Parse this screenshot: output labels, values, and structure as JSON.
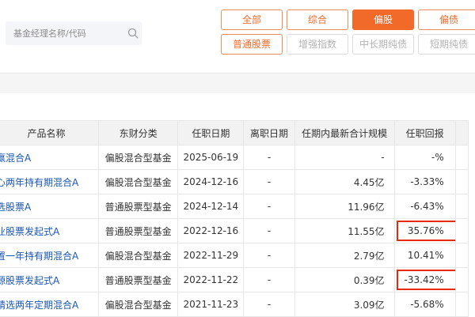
{
  "search": {
    "placeholder": "基金经理名称/代码"
  },
  "filters": {
    "row1": [
      {
        "label": "全部",
        "state": "normal"
      },
      {
        "label": "综合",
        "state": "normal"
      },
      {
        "label": "偏股",
        "state": "active"
      },
      {
        "label": "偏债",
        "state": "normal"
      }
    ],
    "row2": [
      {
        "label": "普通股票",
        "state": "normal"
      },
      {
        "label": "增强指数",
        "state": "disabled"
      },
      {
        "label": "中长期纯债",
        "state": "disabled"
      },
      {
        "label": "短期纯债",
        "state": "disabled"
      }
    ]
  },
  "table": {
    "headers": [
      "产品名称",
      "东财分类",
      "任职日期",
      "离职日期",
      "任期内最新合计规模",
      "任职回报"
    ],
    "rows": [
      {
        "name": "共赢混合A",
        "category": "偏股混合型基金",
        "start": "2025-06-19",
        "end": "-",
        "scale": "-",
        "return": "-%",
        "trend": "none",
        "highlight": false
      },
      {
        "name": "核心两年持有期混合A",
        "category": "偏股混合型基金",
        "start": "2024-12-16",
        "end": "-",
        "scale": "4.45亿",
        "return": "-3.33%",
        "trend": "neg",
        "highlight": false
      },
      {
        "name": "优选股票A",
        "category": "普通股票型基金",
        "start": "2024-12-14",
        "end": "-",
        "scale": "11.96亿",
        "return": "-6.43%",
        "trend": "neg",
        "highlight": false
      },
      {
        "name": "产业股票发起式A",
        "category": "普通股票型基金",
        "start": "2022-12-16",
        "end": "-",
        "scale": "11.55亿",
        "return": "35.76%",
        "trend": "pos",
        "highlight": true
      },
      {
        "name": "配置一年持有期混合A",
        "category": "偏股混合型基金",
        "start": "2022-11-29",
        "end": "-",
        "scale": "2.79亿",
        "return": "10.41%",
        "trend": "pos",
        "highlight": false
      },
      {
        "name": "能源股票发起式A",
        "category": "普通股票型基金",
        "start": "2022-11-22",
        "end": "-",
        "scale": "0.39亿",
        "return": "-33.42%",
        "trend": "neg",
        "highlight": true
      },
      {
        "name": "所精选两年定期混合A",
        "category": "偏股混合型基金",
        "start": "2021-11-23",
        "end": "-",
        "scale": "3.09亿",
        "return": "-5.68%",
        "trend": "neg",
        "highlight": false
      }
    ]
  },
  "colors": {
    "accent": "#f26a2a",
    "positive": "#e8290b",
    "negative": "#1ea33b",
    "link": "#1a56b4"
  }
}
